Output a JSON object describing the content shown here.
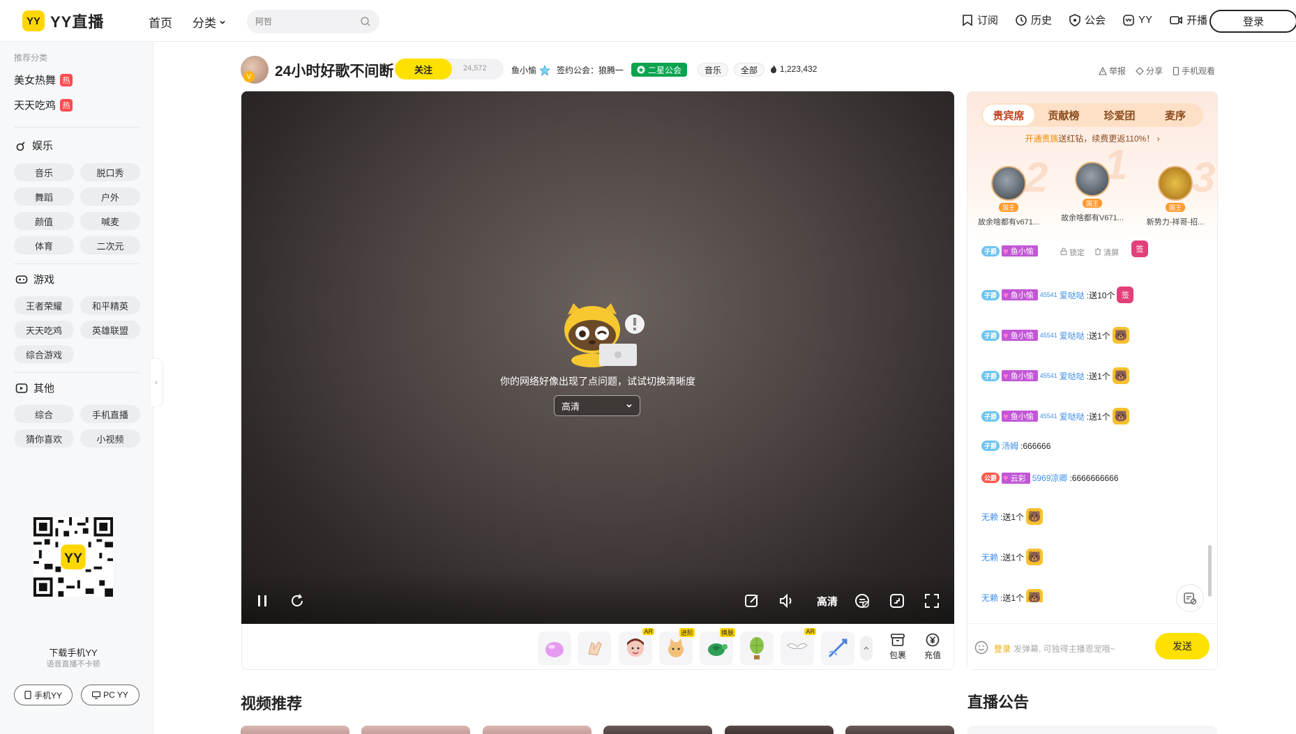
{
  "header": {
    "logo_text": "YY直播",
    "nav_home": "首页",
    "nav_category": "分类",
    "search_placeholder": "阿哲",
    "links": [
      "订阅",
      "历史",
      "公会",
      "YY",
      "开播"
    ],
    "login": "登录"
  },
  "sidebar": {
    "rec_title": "推荐分类",
    "rec_items": [
      "美女热舞",
      "天天吃鸡"
    ],
    "hot_label": "热",
    "sections": [
      {
        "title": "娱乐",
        "chips": [
          "音乐",
          "脱口秀",
          "舞蹈",
          "户外",
          "颜值",
          "喊麦",
          "体育",
          "二次元"
        ]
      },
      {
        "title": "游戏",
        "chips": [
          "王者荣耀",
          "和平精英",
          "天天吃鸡",
          "英雄联盟",
          "综合游戏"
        ]
      },
      {
        "title": "其他",
        "chips": [
          "综合",
          "手机直播",
          "猜你喜欢",
          "小视频"
        ]
      }
    ],
    "download_title": "下载手机YY",
    "download_sub": "语音直播不卡顿",
    "btn_mobile": "手机YY",
    "btn_pc": "PC YY",
    "collapse": "‹"
  },
  "room": {
    "title": "24小时好歌不间断",
    "follow": "关注",
    "follow_count": "24,572",
    "anchor": "鱼小愉",
    "guild_label": "签约公会：狼腾一",
    "star_badge": "二星公会",
    "tags": [
      "音乐",
      "全部"
    ],
    "heat": "1,223,432",
    "util_links": [
      "举报",
      "分享",
      "手机观看"
    ]
  },
  "player": {
    "error_text": "你的网络好像出现了点问题，试试切换清晰度",
    "quality_option": "高清",
    "quality_btn": "高清"
  },
  "gifts": {
    "tags": [
      "AR",
      "进阶",
      "换肤",
      "AR"
    ],
    "package": "包裹",
    "recharge": "充值"
  },
  "sections": {
    "video_rec": "视频推荐",
    "announcement": "直播公告"
  },
  "rank": {
    "tabs": [
      "贵宾席",
      "贡献榜",
      "珍爱团",
      "麦序"
    ],
    "promo_highlight": "开通贵族",
    "promo_rest": "送红钻，续费更返110%！",
    "seats": [
      {
        "name": "故余啥都有v671...",
        "badge": "国王",
        "num": "2"
      },
      {
        "name": "故余啥都有V671...",
        "badge": "国王",
        "num": "1"
      },
      {
        "name": "新势力-祥哥-招...",
        "badge": "国王",
        "num": "3"
      }
    ]
  },
  "chat": {
    "lock": "锁定",
    "clear": "清屏",
    "rows": [
      {
        "tag": "子爵",
        "fan": "鱼小愉",
        "lv": "45",
        "sup": "45541",
        "user": "爱哒哒",
        "text": ":送10个",
        "gift": "sign"
      },
      {
        "tag": "子爵",
        "fan": "鱼小愉",
        "lv": "45",
        "sup": "45541",
        "user": "爱哒哒",
        "text": ":送1个",
        "gift": "bear"
      },
      {
        "tag": "子爵",
        "fan": "鱼小愉",
        "lv": "45",
        "sup": "45541",
        "user": "爱哒哒",
        "text": ":送1个",
        "gift": "bear"
      },
      {
        "tag": "子爵",
        "fan": "鱼小愉",
        "lv": "45",
        "sup": "45541",
        "user": "爱哒哒",
        "text": ":送1个",
        "gift": "bear"
      }
    ],
    "row_tang": {
      "tag": "子爵",
      "user": "汤姆",
      "text": ":666666"
    },
    "row_gh": {
      "tag": "公爵",
      "fan": "云彩",
      "user": "5969凉卿",
      "text": ":6666666666"
    },
    "row_wl": [
      {
        "user": "无赖",
        "text": ":送1个"
      },
      {
        "user": "无赖",
        "text": ":送1个"
      },
      {
        "user": "无赖",
        "text": ":送1个"
      }
    ],
    "input_login": "登录",
    "input_placeholder": "发弹幕, 可独得主播恩宠哦~",
    "send": "发送"
  }
}
